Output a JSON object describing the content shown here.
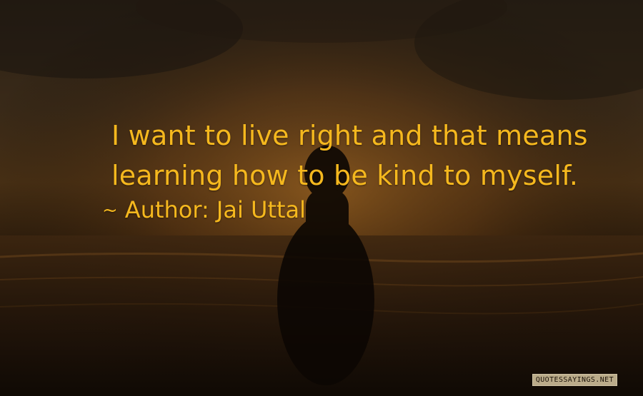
{
  "quote": {
    "lines": [
      "I want to live right and that means",
      "learning how to be kind to myself."
    ],
    "tilde": "~",
    "author_label": "Author: Jai Uttal"
  },
  "watermark": "QUOTESSAYINGS.NET",
  "colors": {
    "quote_text": "#f5b81e",
    "sky_dark": "#2b2116",
    "sunset_glow": "#7a4a16",
    "sea_dark": "#120b05"
  }
}
